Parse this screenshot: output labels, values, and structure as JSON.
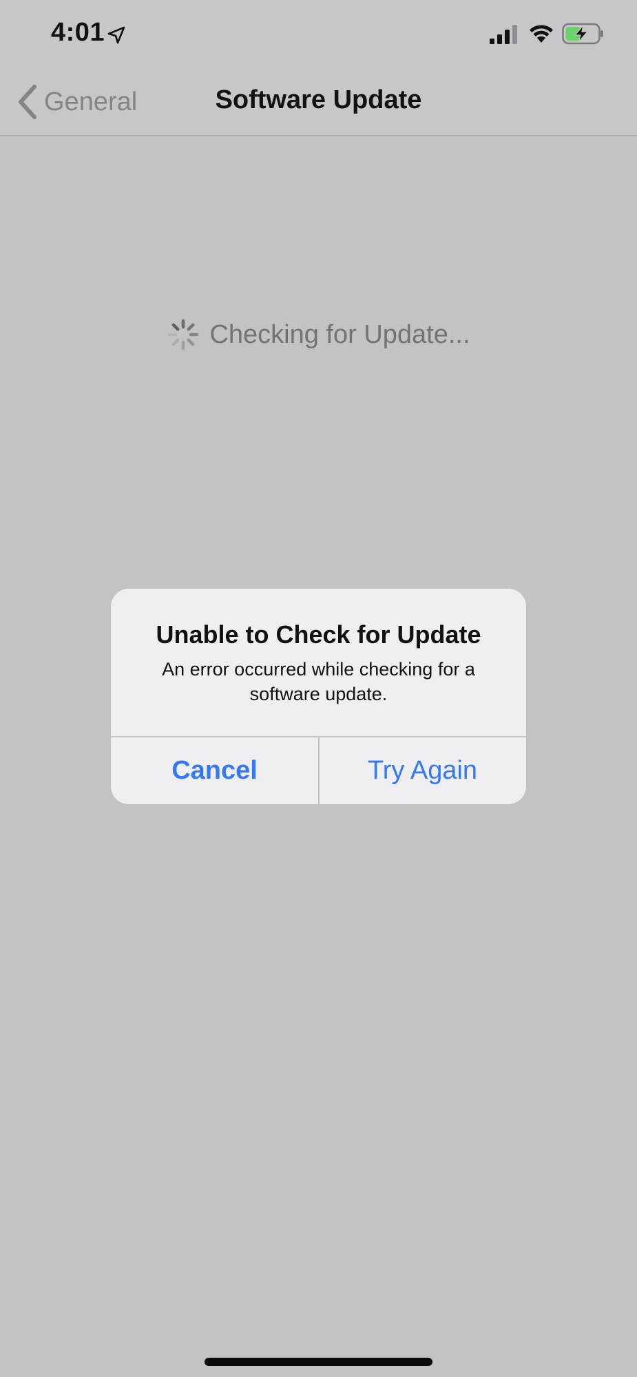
{
  "status_bar": {
    "time": "4:01",
    "location_icon": "location-arrow-icon",
    "signal_icon": "cellular-signal-icon",
    "wifi_icon": "wifi-icon",
    "battery_icon": "battery-charging-icon",
    "battery_color": "#6dd26a"
  },
  "nav": {
    "back_label": "General",
    "title": "Software Update"
  },
  "content": {
    "status_text": "Checking for Update...",
    "spinner_icon": "activity-spinner-icon"
  },
  "alert": {
    "title": "Unable to Check for Update",
    "message": "An error occurred while checking for a software update.",
    "cancel_label": "Cancel",
    "retry_label": "Try Again",
    "accent_color": "#3478f6"
  }
}
